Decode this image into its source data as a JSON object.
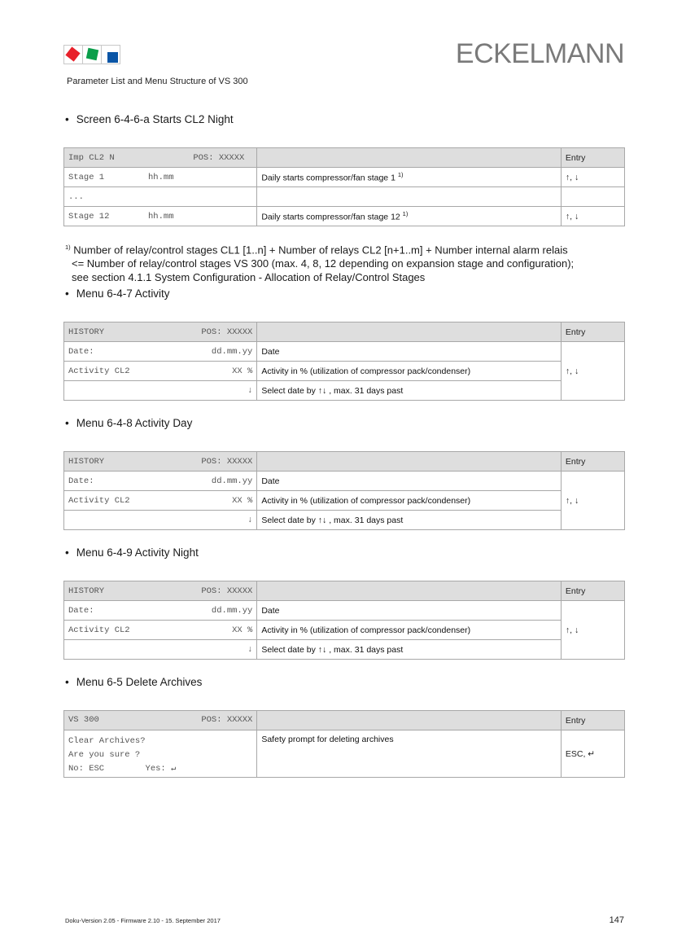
{
  "header": {
    "brand": "ECKELMANN",
    "subtitle": "Parameter List and Menu Structure of VS 300",
    "logo_colors": [
      "#e8202a",
      "#0a9e4a",
      "#0a55a6"
    ]
  },
  "sections": [
    {
      "title": "Screen 6-4-6-a Starts CL2 Night",
      "header": {
        "left": "Imp CL2 N",
        "right": "POS: XXXXX",
        "desc": "",
        "entry": "Entry"
      },
      "rows": [
        {
          "left": "Stage 1",
          "value": "hh.mm",
          "desc": "Daily starts compressor/fan stage 1",
          "sup": "1)",
          "entry": "↑, ↓"
        },
        {
          "left": "...",
          "value": "",
          "desc": "",
          "sup": "",
          "entry": ""
        },
        {
          "left": "Stage 12",
          "value": "hh.mm",
          "desc": "Daily starts compressor/fan stage 12",
          "sup": "1)",
          "entry": "↑, ↓"
        }
      ]
    },
    {
      "title": "Menu 6-4-7 Activity",
      "header": {
        "left": "HISTORY",
        "right": "POS: XXXXX",
        "desc": "",
        "entry": "Entry"
      },
      "rows": [
        {
          "left": "Date:",
          "value": "dd.mm.yy",
          "desc": "Date"
        },
        {
          "left": "Activity CL2",
          "value": "XX %",
          "desc": "Activity in % (utilization of compressor pack/condenser)"
        },
        {
          "left": "",
          "value": "↓",
          "desc": "Select date by ↑↓ , max. 31 days past"
        }
      ],
      "entry": "↑, ↓"
    },
    {
      "title": "Menu 6-4-8 Activity Day",
      "header": {
        "left": "HISTORY",
        "right": "POS: XXXXX",
        "desc": "",
        "entry": "Entry"
      },
      "rows": [
        {
          "left": "Date:",
          "value": "dd.mm.yy",
          "desc": "Date"
        },
        {
          "left": "Activity CL2",
          "value": "XX %",
          "desc": "Activity in % (utilization of compressor pack/condenser)"
        },
        {
          "left": "",
          "value": "↓",
          "desc": "Select date by ↑↓ , max. 31 days past"
        }
      ],
      "entry": "↑, ↓"
    },
    {
      "title": "Menu 6-4-9 Activity Night",
      "header": {
        "left": "HISTORY",
        "right": "POS: XXXXX",
        "desc": "",
        "entry": "Entry"
      },
      "rows": [
        {
          "left": "Date:",
          "value": "dd.mm.yy",
          "desc": "Date"
        },
        {
          "left": "Activity CL2",
          "value": "XX %",
          "desc": "Activity in % (utilization of compressor pack/condenser)"
        },
        {
          "left": "",
          "value": "↓",
          "desc": "Select date by ↑↓ , max. 31 days past"
        }
      ],
      "entry": "↑, ↓"
    },
    {
      "title": "Menu 6-5 Delete Archives",
      "header": {
        "left": "VS 300",
        "right": "POS: XXXXX",
        "desc": "",
        "entry": "Entry"
      },
      "lines": [
        "Clear Archives?",
        "Are you sure ?",
        "No: ESC        Yes: ↵"
      ],
      "desc": "Safety prompt for deleting archives",
      "entry": "ESC, ↵"
    }
  ],
  "footnote": {
    "marker": "1)",
    "line1": "Number of relay/control stages CL1 [1..n] + Number of relays CL2 [n+1..m] + Number internal alarm relais",
    "line2": "<= Number of relay/control stages VS 300 (max. 4, 8, 12 depending on expansion stage and configuration);",
    "line3": "see section 4.1.1 System Configuration - Allocation of Relay/Control Stages"
  },
  "footer": {
    "left": "Doku-Version 2.05 - Firmware 2.10 - 15. September 2017",
    "page": "147"
  }
}
